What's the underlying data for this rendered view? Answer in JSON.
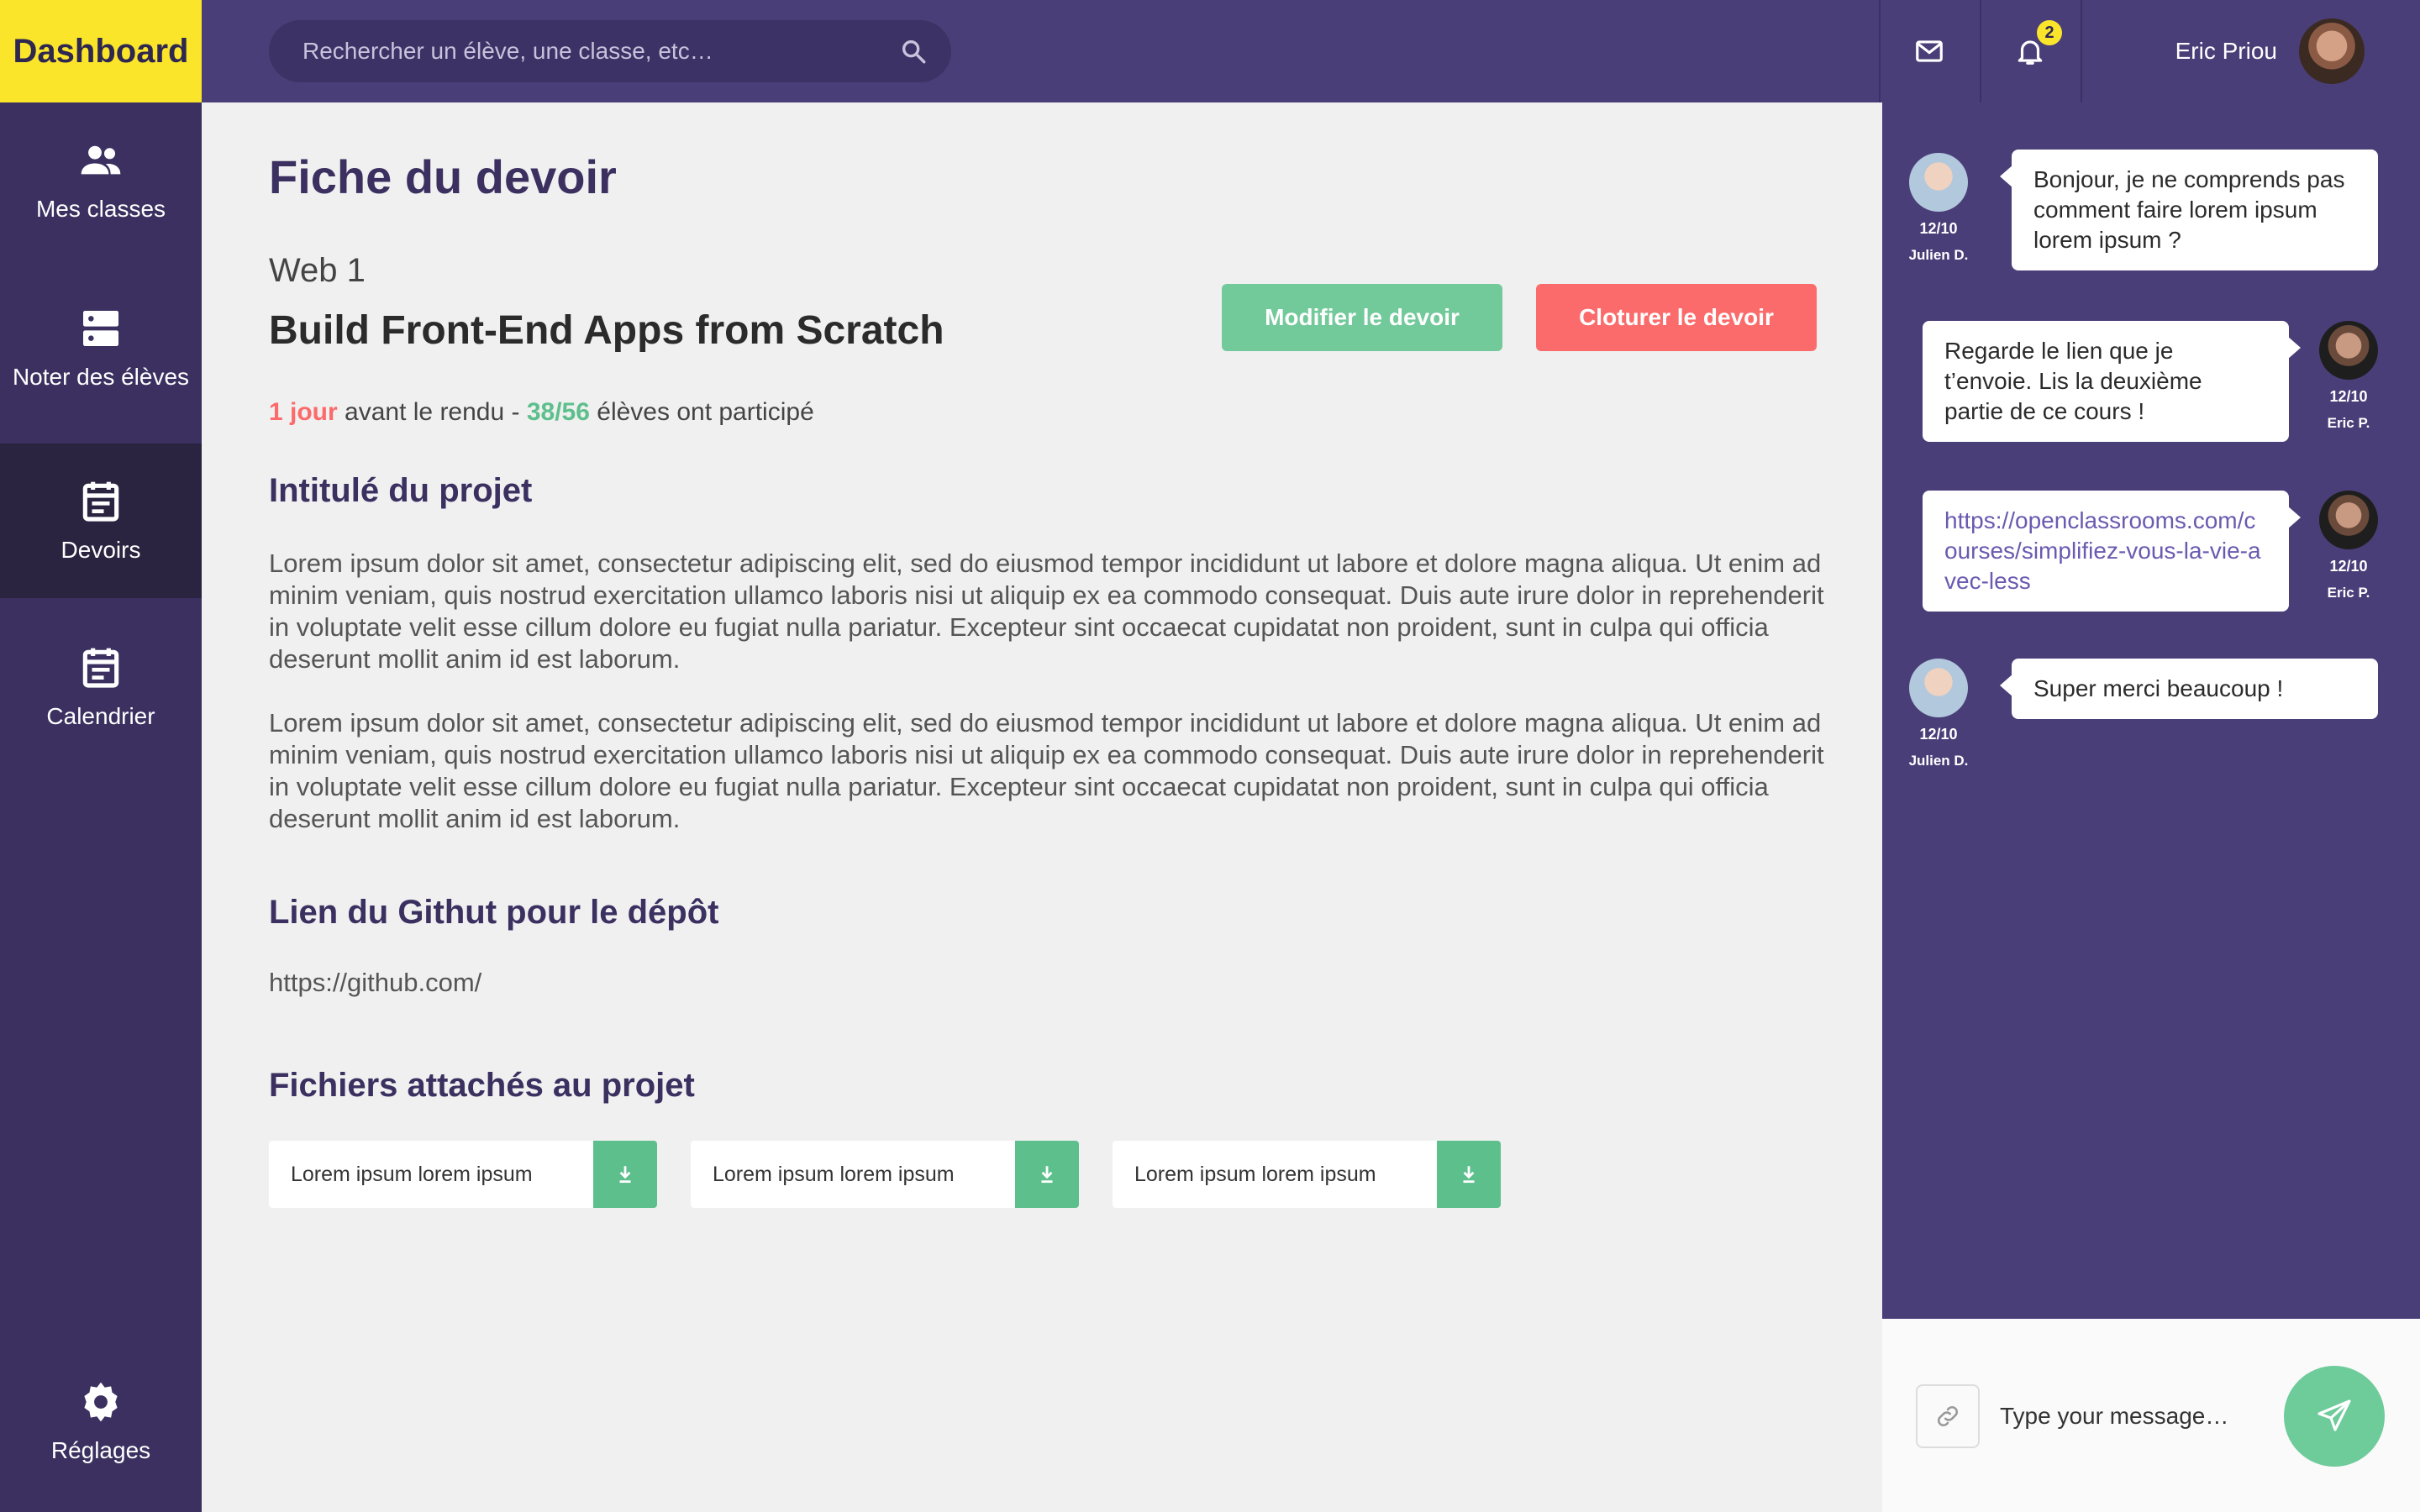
{
  "brand": {
    "logo": "Dashboard",
    "colors": {
      "primary": "#4a3e78",
      "sidebar": "#3b3060",
      "accent_yellow": "#fbe52b",
      "green": "#72c99a",
      "red": "#fb6b6b"
    }
  },
  "header": {
    "search_placeholder": "Rechercher un élève, une classe, etc…",
    "notifications_count": "2",
    "user_name": "Eric Priou",
    "icons": [
      "search-icon",
      "mail-icon",
      "bell-icon",
      "avatar"
    ]
  },
  "sidebar": {
    "items": [
      {
        "label": "Mes classes",
        "icon": "people-icon"
      },
      {
        "label": "Noter des élèves",
        "icon": "storage-icon"
      },
      {
        "label": "Devoirs",
        "icon": "assignment-icon",
        "active": true
      },
      {
        "label": "Calendrier",
        "icon": "calendar-icon"
      }
    ],
    "settings": {
      "label": "Réglages",
      "icon": "gear-icon"
    }
  },
  "main": {
    "page_title": "Fiche du devoir",
    "class_name": "Web 1",
    "project_title": "Build Front-End Apps from Scratch",
    "buttons": {
      "edit": "Modifier le devoir",
      "close": "Cloturer le devoir"
    },
    "status": {
      "days": "1 jour",
      "before": "avant le rendu -",
      "participation": "38/56",
      "after": "élèves ont participé"
    },
    "section_project": "Intitulé du projet",
    "paragraphs": [
      "Lorem ipsum dolor sit amet, consectetur adipiscing elit, sed do eiusmod tempor incididunt ut labore et dolore magna aliqua. Ut enim ad minim veniam, quis nostrud exercitation ullamco laboris nisi ut aliquip ex ea commodo consequat. Duis aute irure dolor in reprehenderit in voluptate velit esse cillum dolore eu fugiat nulla pariatur. Excepteur sint occaecat cupidatat non proident, sunt in culpa qui officia deserunt mollit anim id est laborum.",
      "Lorem ipsum dolor sit amet, consectetur adipiscing elit, sed do eiusmod tempor incididunt ut labore et dolore magna aliqua. Ut enim ad minim veniam, quis nostrud exercitation ullamco laboris nisi ut aliquip ex ea commodo consequat. Duis aute irure dolor in reprehenderit in voluptate velit esse cillum dolore eu fugiat nulla pariatur. Excepteur sint occaecat cupidatat non proident, sunt in culpa qui officia deserunt mollit anim id est laborum."
    ],
    "section_github": "Lien du Githut pour le dépôt",
    "github_link": "https://github.com/",
    "section_files": "Fichiers attachés au projet",
    "files": [
      "Lorem ipsum lorem ipsum",
      "Lorem ipsum lorem ipsum",
      "Lorem ipsum lorem ipsum"
    ]
  },
  "chat": {
    "messages": [
      {
        "author": "Julien D.",
        "date": "12/10",
        "text": "Bonjour, je ne comprends pas comment faire lorem ipsum lorem ipsum ?",
        "side": "left"
      },
      {
        "author": "Eric P.",
        "date": "12/10",
        "text": "Regarde le lien que je t’envoie. Lis la deuxième partie de ce cours !",
        "side": "right"
      },
      {
        "author": "Eric P.",
        "date": "12/10",
        "text": "https://openclassrooms.com/courses/simplifiez-vous-la-vie-avec-less",
        "side": "right",
        "link": true
      },
      {
        "author": "Julien D.",
        "date": "12/10",
        "text": "Super merci beaucoup !",
        "side": "left"
      }
    ],
    "composer_placeholder": "Type your message…"
  }
}
